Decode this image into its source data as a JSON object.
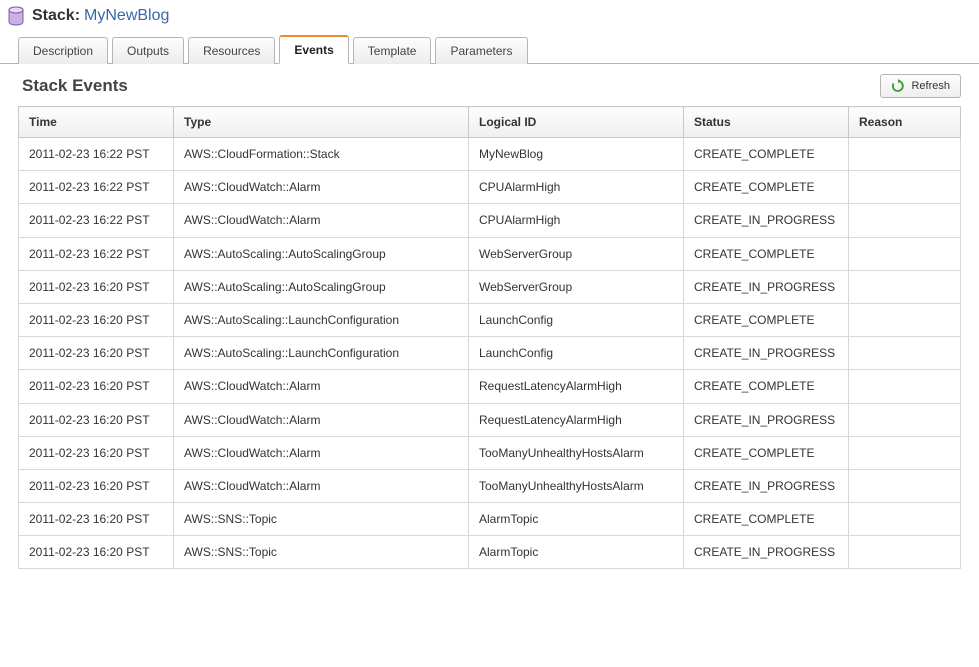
{
  "header": {
    "stack_label": "Stack:",
    "stack_name": "MyNewBlog"
  },
  "tabs": [
    {
      "label": "Description",
      "active": false
    },
    {
      "label": "Outputs",
      "active": false
    },
    {
      "label": "Resources",
      "active": false
    },
    {
      "label": "Events",
      "active": true
    },
    {
      "label": "Template",
      "active": false
    },
    {
      "label": "Parameters",
      "active": false
    }
  ],
  "section": {
    "title": "Stack Events",
    "refresh_label": "Refresh"
  },
  "table": {
    "columns": [
      "Time",
      "Type",
      "Logical ID",
      "Status",
      "Reason"
    ],
    "rows": [
      {
        "time": "2011-02-23 16:22 PST",
        "type": "AWS::CloudFormation::Stack",
        "logical_id": "MyNewBlog",
        "status": "CREATE_COMPLETE",
        "reason": ""
      },
      {
        "time": "2011-02-23 16:22 PST",
        "type": "AWS::CloudWatch::Alarm",
        "logical_id": "CPUAlarmHigh",
        "status": "CREATE_COMPLETE",
        "reason": ""
      },
      {
        "time": "2011-02-23 16:22 PST",
        "type": "AWS::CloudWatch::Alarm",
        "logical_id": "CPUAlarmHigh",
        "status": "CREATE_IN_PROGRESS",
        "reason": ""
      },
      {
        "time": "2011-02-23 16:22 PST",
        "type": "AWS::AutoScaling::AutoScalingGroup",
        "logical_id": "WebServerGroup",
        "status": "CREATE_COMPLETE",
        "reason": ""
      },
      {
        "time": "2011-02-23 16:20 PST",
        "type": "AWS::AutoScaling::AutoScalingGroup",
        "logical_id": "WebServerGroup",
        "status": "CREATE_IN_PROGRESS",
        "reason": ""
      },
      {
        "time": "2011-02-23 16:20 PST",
        "type": "AWS::AutoScaling::LaunchConfiguration",
        "logical_id": "LaunchConfig",
        "status": "CREATE_COMPLETE",
        "reason": ""
      },
      {
        "time": "2011-02-23 16:20 PST",
        "type": "AWS::AutoScaling::LaunchConfiguration",
        "logical_id": "LaunchConfig",
        "status": "CREATE_IN_PROGRESS",
        "reason": ""
      },
      {
        "time": "2011-02-23 16:20 PST",
        "type": "AWS::CloudWatch::Alarm",
        "logical_id": "RequestLatencyAlarmHigh",
        "status": "CREATE_COMPLETE",
        "reason": ""
      },
      {
        "time": "2011-02-23 16:20 PST",
        "type": "AWS::CloudWatch::Alarm",
        "logical_id": "RequestLatencyAlarmHigh",
        "status": "CREATE_IN_PROGRESS",
        "reason": ""
      },
      {
        "time": "2011-02-23 16:20 PST",
        "type": "AWS::CloudWatch::Alarm",
        "logical_id": "TooManyUnhealthyHostsAlarm",
        "status": "CREATE_COMPLETE",
        "reason": ""
      },
      {
        "time": "2011-02-23 16:20 PST",
        "type": "AWS::CloudWatch::Alarm",
        "logical_id": "TooManyUnhealthyHostsAlarm",
        "status": "CREATE_IN_PROGRESS",
        "reason": ""
      },
      {
        "time": "2011-02-23 16:20 PST",
        "type": "AWS::SNS::Topic",
        "logical_id": "AlarmTopic",
        "status": "CREATE_COMPLETE",
        "reason": ""
      },
      {
        "time": "2011-02-23 16:20 PST",
        "type": "AWS::SNS::Topic",
        "logical_id": "AlarmTopic",
        "status": "CREATE_IN_PROGRESS",
        "reason": ""
      }
    ]
  }
}
